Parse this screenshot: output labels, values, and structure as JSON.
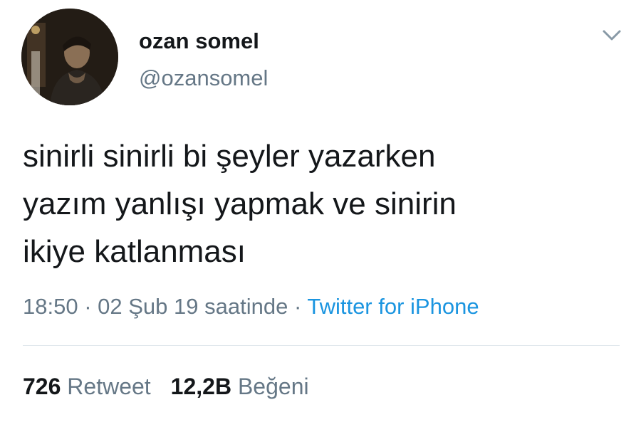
{
  "author": {
    "display_name": "ozan somel",
    "handle": "@ozansomel"
  },
  "menu_icon": "chevron-down-icon",
  "tweet": {
    "text": "sinirli sinirli bi şeyler yazarken\nyazım yanlışı yapmak ve sinirin\nikiye katlanması",
    "time": "18:50",
    "separator": "·",
    "date": "02 Şub 19 saatinde",
    "source": "Twitter for iPhone"
  },
  "stats": {
    "retweets_count": "726",
    "retweets_label": "Retweet",
    "likes_count": "12,2B",
    "likes_label": "Beğeni"
  },
  "colors": {
    "text_primary": "#14171a",
    "text_secondary": "#657786",
    "link": "#1b95e0",
    "divider": "#e1e8ed"
  }
}
